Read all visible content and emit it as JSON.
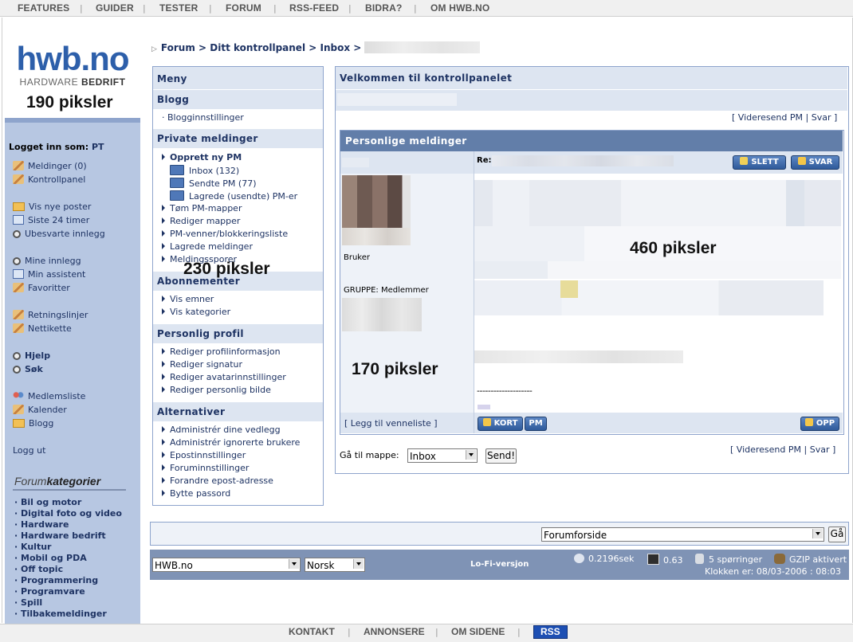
{
  "topnav": [
    "FEATURES",
    "GUIDER",
    "TESTER",
    "FORUM",
    "RSS-FEED",
    "BIDRA?",
    "OM HWB.NO"
  ],
  "logo": {
    "main": "hwb.no",
    "sub_a": "HARDWARE ",
    "sub_b": "BEDRIFT"
  },
  "annotations": {
    "logo_width": "190 piksler",
    "menu_width": "230 piksler",
    "sender_width": "170 piksler",
    "message_width": "460 piksler"
  },
  "sidebar": {
    "logged_in_label": "Logget inn som:",
    "logged_in_user": "PT",
    "links": [
      "Meldinger (0)",
      "Kontrollpanel",
      "Vis nye poster",
      "Siste 24 timer",
      "Ubesvarte innlegg",
      "Mine innlegg",
      "Min assistent",
      "Favoritter",
      "Retningslinjer",
      "Nettikette",
      "Hjelp",
      "Søk",
      "Medlemsliste",
      "Kalender",
      "Blogg"
    ],
    "logout": "Logg ut",
    "cat_title_a": "Forum",
    "cat_title_b": "kategorier",
    "categories": [
      "Bil og motor",
      "Digital foto og video",
      "Hardware",
      "Hardware bedrift",
      "Kultur",
      "Mobil og PDA",
      "Off topic",
      "Programmering",
      "Programvare",
      "Spill",
      "Tilbakemeldinger"
    ]
  },
  "breadcrumb": {
    "forum": "Forum",
    "control_panel": "Ditt kontrollpanel",
    "inbox": "Inbox",
    "sep": ">"
  },
  "menu": {
    "title": "Meny",
    "blog_head": "Blogg",
    "blog_items": [
      "Blogginnstillinger"
    ],
    "pm_head": "Private meldinger",
    "pm_new": "Opprett ny PM",
    "pm_folders": [
      "Inbox (132)",
      "Sendte PM (77)",
      "Lagrede (usendte) PM-er"
    ],
    "pm_items": [
      "Tøm PM-mapper",
      "Rediger mapper",
      "PM-venner/blokkeringsliste",
      "Lagrede meldinger",
      "Meldingssporer"
    ],
    "sub_head": "Abonnementer",
    "sub_items": [
      "Vis emner",
      "Vis kategorier"
    ],
    "profile_head": "Personlig profil",
    "profile_items": [
      "Rediger profilinformasjon",
      "Rediger signatur",
      "Rediger avatarinnstillinger",
      "Rediger personlig bilde"
    ],
    "alt_head": "Alternativer",
    "alt_items": [
      "Administrér dine vedlegg",
      "Administrér ignorerte brukere",
      "Epostinnstillinger",
      "Foruminnstillinger",
      "Forandre epost-adresse",
      "Bytte passord"
    ]
  },
  "main": {
    "title": "Velkommen til kontrollpanelet",
    "links_open": "[",
    "forward": "Videresend PM",
    "pipe": "|",
    "reply": "Svar",
    "links_close": "]",
    "pm_title": "Personlige meldinger",
    "re_label": "Re:",
    "delete_btn": "SLETT",
    "reply_btn": "SVAR",
    "user_role": "Bruker",
    "group": "GRUPPE: Medlemmer",
    "signature_dashes": "--------------------",
    "add_friend": "[ Legg til venneliste ]",
    "card_btn": "KORT",
    "pm_btn": "PM",
    "up_btn": "OPP",
    "goto_label": "Gå til mappe:",
    "goto_value": "Inbox",
    "send_btn": "Send!"
  },
  "forumjump": {
    "value": "Forumforside",
    "go": "Gå"
  },
  "statusbar": {
    "site_select": "HWB.no",
    "lang_select": "Norsk",
    "lofi": "Lo-Fi-versjon",
    "time": "0.2196sek",
    "load": "0.63",
    "queries": "5 spørringer",
    "gzip": "GZIP aktivert",
    "clock": "Klokken er: 08/03-2006 : 08:03"
  },
  "footer": [
    "KONTAKT",
    "ANNONSERE",
    "OM SIDENE",
    "RSS"
  ],
  "colors": {
    "accent": "#1e3363",
    "panel": "#b7c7e2",
    "header_bar": "#627ea9",
    "light_bar": "#dde5f1",
    "rss": "#1d4fb3"
  }
}
